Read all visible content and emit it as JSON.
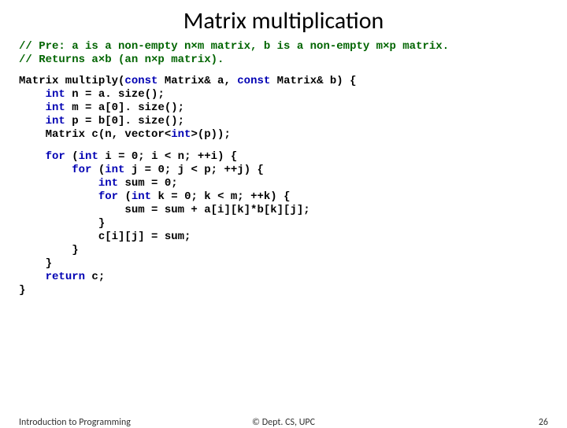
{
  "title": "Matrix multiplication",
  "cmt1": "// Pre: a is a non-empty n×m matrix, b is a non-empty m×p matrix.",
  "cmt2": "// Returns a×b (an n×p matrix).",
  "l1a": "Matrix multiply(",
  "kw_const1": "const",
  "l1b": " Matrix& a, ",
  "kw_const2": "const",
  "l1c": " Matrix& b) {",
  "l2a": "    ",
  "kw_int1": "int",
  "l2b": " n = a. size();",
  "l3a": "    ",
  "kw_int2": "int",
  "l3b": " m = a[0]. size();",
  "l4a": "    ",
  "kw_int3": "int",
  "l4b": " p = b[0]. size();",
  "l5": "    Matrix c(n, vector<",
  "kw_int4": "int",
  "l5b": ">(p));",
  "l6a": "    ",
  "kw_for1": "for",
  "l6b": " (",
  "kw_int5": "int",
  "l6c": " i = 0; i < n; ++i) {",
  "l7a": "        ",
  "kw_for2": "for",
  "l7b": " (",
  "kw_int6": "int",
  "l7c": " j = 0; j < p; ++j) {",
  "l8a": "            ",
  "kw_int7": "int",
  "l8b": " sum = 0;",
  "l9a": "            ",
  "kw_for3": "for",
  "l9b": " (",
  "kw_int8": "int",
  "l9c": " k = 0; k < m; ++k) {",
  "l10": "                sum = sum + a[i][k]*b[k][j];",
  "l11": "            }",
  "l12": "            c[i][j] = sum;",
  "l13": "        }",
  "l14": "    }",
  "l15a": "    ",
  "kw_return": "return",
  "l15b": " c;",
  "l16": "}",
  "footer_left": "Introduction to Programming",
  "footer_center": "© Dept. CS, UPC",
  "footer_right": "26"
}
